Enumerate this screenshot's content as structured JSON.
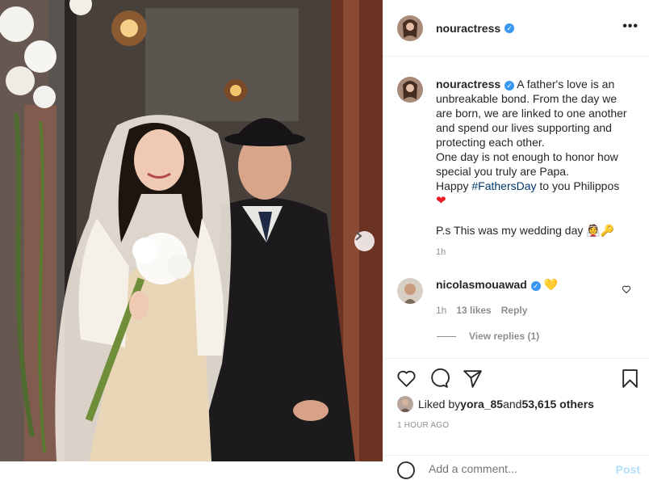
{
  "post": {
    "username": "nouractress",
    "more_label": "•••",
    "caption": {
      "line1": "A father's love is an unbreakable bond. From the day we are born, we are linked to one another and spend our lives supporting and protecting each other.",
      "line2": "One day is not enough to honor how special you truly are Papa.",
      "line3_prefix": "Happy ",
      "hashtag": "#FathersDay",
      "line3_suffix": " to you Philippos",
      "heart": "❤",
      "ps": "P.s This was my wedding day 👰🔑",
      "time": "1h"
    },
    "comment": {
      "username": "nicolasmouawad",
      "emoji": "💛",
      "time": "1h",
      "likes": "13 likes",
      "reply": "Reply"
    },
    "view_replies": "View replies (1)",
    "liked_by": {
      "prefix": "Liked by ",
      "user": "yora_85",
      "middle": " and ",
      "others": "53,615 others"
    },
    "timestamp": "1 HOUR AGO",
    "add_comment_placeholder": "Add a comment...",
    "post_button": "Post"
  },
  "icons": {
    "next": "chevron-right-icon",
    "like": "heart-icon",
    "comment": "comment-icon",
    "share": "paper-plane-icon",
    "save": "bookmark-icon",
    "emoji": "smile-icon"
  },
  "colors": {
    "verified": "#3897f0",
    "hashtag": "#00376b",
    "muted": "#8e8e8e",
    "post_button": "#b2dffc"
  }
}
